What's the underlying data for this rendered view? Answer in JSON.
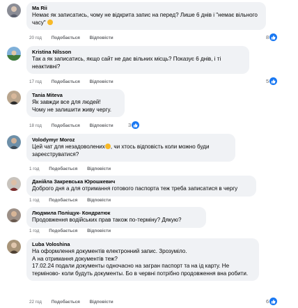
{
  "comments": [
    {
      "author": "Ma Rii",
      "text": "Немає як записатись, чому не відкрита запис на перед? Лише 6 днів і \"немає вільного часу\"",
      "emoji": "slightly-frowning-face",
      "time": "20 год",
      "like": "Подобається",
      "reply": "Відповісти",
      "reactions": "8"
    },
    {
      "author": "Kristina Nilsson",
      "text": "Так а як записатись, якщо сайт не дає вільних місць? Показує 6 днів, і ті неактивні?",
      "time": "17 год",
      "like": "Подобається",
      "reply": "Відповісти",
      "reactions": "5"
    },
    {
      "author": "Tania Miteva",
      "text_line1": "Як завжди все для людей!",
      "text_line2": "Чому не залишити живу чергу.",
      "time": "18 год",
      "like": "Подобається",
      "reply": "Відповісти",
      "reactions": "3"
    },
    {
      "author": "Volodymyr Moroz",
      "text_before_emoji": "Цей чат для незадоволених",
      "emoji": "smiling-face",
      "text_after_emoji": ", чи хтось відповість коли можно буди зареєструватися?",
      "time": "1 год",
      "like": "Подобається",
      "reply": "Відповісти"
    },
    {
      "author": "Данійла Закревська Юрошкевич",
      "text": "Доброго дня а для отримання готового паспорта теж треба записатися в чергу",
      "time": "1 год",
      "like": "Подобається",
      "reply": "Відповісти"
    },
    {
      "author": "Людмила Поліщук- Кондратюк",
      "text": "Продовження водійських прав також по-терміну? Дякую?",
      "time": "1 год",
      "like": "Подобається",
      "reply": "Відповісти"
    },
    {
      "author": "Luba Voloshina",
      "text_line1": "На оформлення документів електронний запис. Зрозуміло.",
      "text_line2": "А на отримання документів теж?",
      "text_line3": "17.02.24 подали документы одночасно на загран паспорт та на ід карту. Не терміново- коли будуть документы. Бо в червні потрібно продовження вна робити.",
      "time": "22 год",
      "like": "Подобається",
      "reply": "Відповісти",
      "reactions": "6"
    }
  ],
  "colors": {
    "bubble": "#f0f2f5",
    "meta": "#65676b",
    "like": "#1877f2"
  }
}
